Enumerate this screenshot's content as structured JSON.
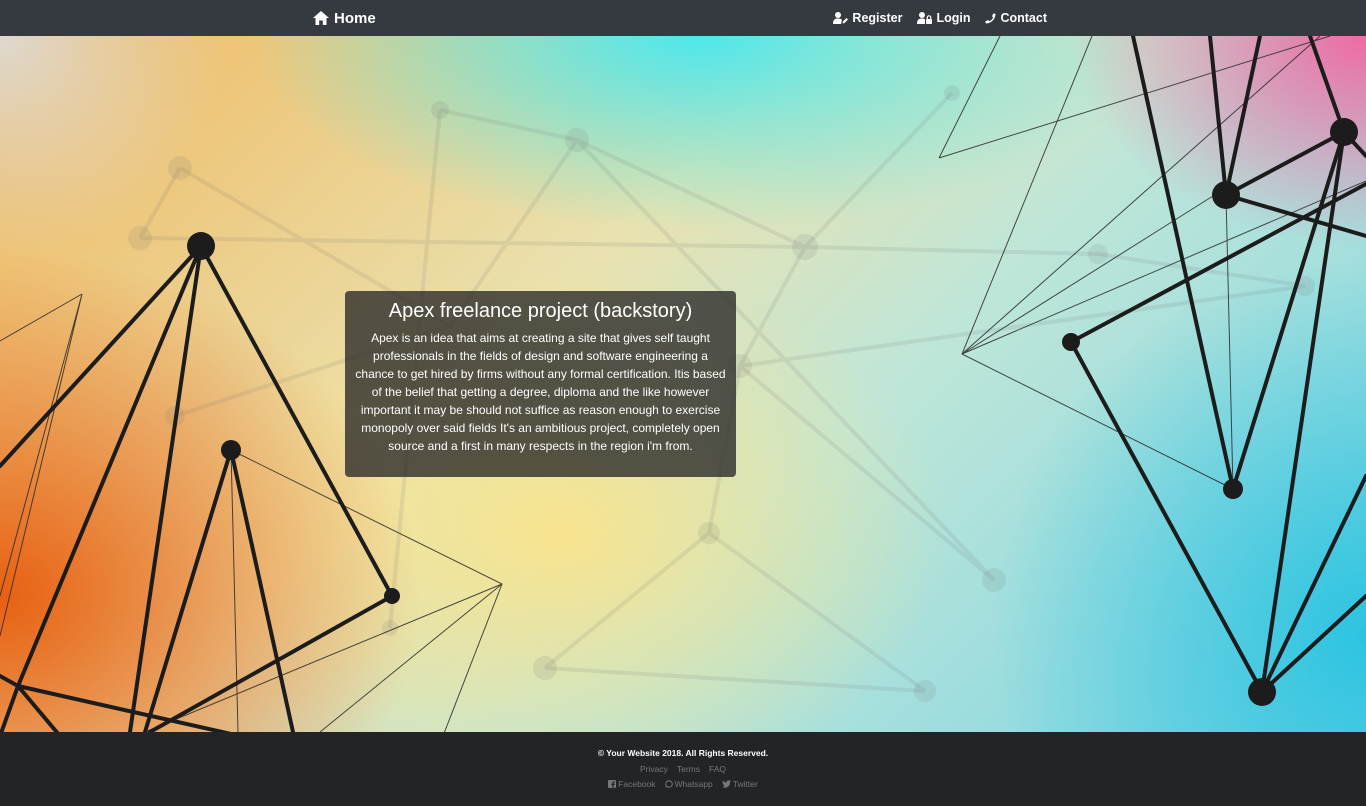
{
  "nav": {
    "home_label": "Home",
    "home_icon": "home-icon",
    "links": [
      {
        "label": "Register",
        "icon": "user-edit-icon"
      },
      {
        "label": "Login",
        "icon": "user-lock-icon"
      },
      {
        "label": "Contact",
        "icon": "phone-icon"
      }
    ]
  },
  "card": {
    "title": "Apex freelance project (backstory)",
    "text": "Apex is an idea that aims at creating a site that gives self taught professionals in the fields of design and software engineering a chance to get hired by firms without any formal certification. Itis based of the belief that getting a degree, diploma and the like however important it may be should not suffice as reason enough to exercise monopoly over said fields It's an ambitious project, completely open source and a first in many respects in the region i'm from."
  },
  "footer": {
    "copyright": "© Your Website 2018. All Rights Reserved.",
    "links": [
      "Privacy",
      "Terms",
      "FAQ"
    ],
    "social": [
      {
        "label": "Facebook",
        "icon": "facebook-icon"
      },
      {
        "label": "Whatsapp",
        "icon": "whatsapp-icon"
      },
      {
        "label": "Twitter",
        "icon": "twitter-icon"
      }
    ]
  },
  "colors": {
    "navbar_bg": "#343a40",
    "footer_bg": "#222428",
    "card_bg": "rgba(40,40,40,0.78)"
  }
}
